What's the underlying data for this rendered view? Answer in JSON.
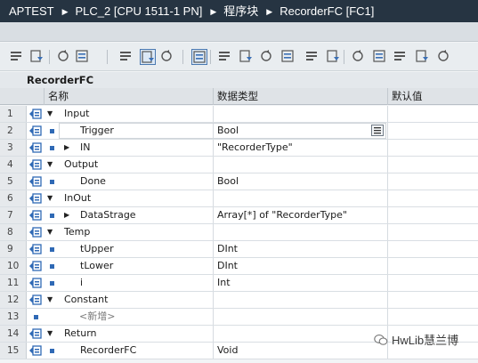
{
  "breadcrumb": {
    "project": "APTEST",
    "device": "PLC_2 [CPU 1511-1 PN]",
    "folder": "程序块",
    "block": "RecorderFC [FC1]"
  },
  "block_name": "RecorderFC",
  "columns": {
    "name": "名称",
    "datatype": "数据类型",
    "default": "默认值"
  },
  "rows": [
    {
      "num": "1",
      "name": "Input",
      "type": "",
      "level": 0,
      "expand": "down"
    },
    {
      "num": "2",
      "name": "Trigger",
      "type": "Bool",
      "level": 1,
      "expand": ""
    },
    {
      "num": "3",
      "name": "IN",
      "type": "\"RecorderType\"",
      "level": 1,
      "expand": "right"
    },
    {
      "num": "4",
      "name": "Output",
      "type": "",
      "level": 0,
      "expand": "down"
    },
    {
      "num": "5",
      "name": "Done",
      "type": "Bool",
      "level": 1,
      "expand": ""
    },
    {
      "num": "6",
      "name": "InOut",
      "type": "",
      "level": 0,
      "expand": "down"
    },
    {
      "num": "7",
      "name": "DataStrage",
      "type": "Array[*] of \"RecorderType\"",
      "level": 1,
      "expand": "right"
    },
    {
      "num": "8",
      "name": "Temp",
      "type": "",
      "level": 0,
      "expand": "down"
    },
    {
      "num": "9",
      "name": "tUpper",
      "type": "DInt",
      "level": 1,
      "expand": ""
    },
    {
      "num": "10",
      "name": "tLower",
      "type": "DInt",
      "level": 1,
      "expand": ""
    },
    {
      "num": "11",
      "name": "i",
      "type": "Int",
      "level": 1,
      "expand": ""
    },
    {
      "num": "12",
      "name": "Constant",
      "type": "",
      "level": 0,
      "expand": "down"
    },
    {
      "num": "13",
      "name": "<新增>",
      "type": "",
      "level": 1,
      "expand": "",
      "placeholder": true
    },
    {
      "num": "14",
      "name": "Return",
      "type": "",
      "level": 0,
      "expand": "down"
    },
    {
      "num": "15",
      "name": "RecorderFC",
      "type": "Void",
      "level": 1,
      "expand": ""
    }
  ],
  "selected_row": 2,
  "watermark": "HwLib慧兰博",
  "colors": {
    "titlebar": "#263442",
    "icon_blue": "#2f69b5"
  }
}
